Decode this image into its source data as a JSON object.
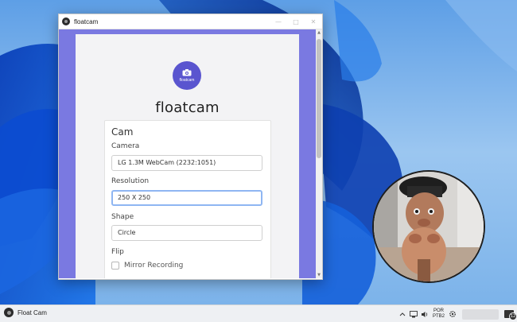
{
  "window": {
    "title": "floatcam"
  },
  "logo": {
    "caption": "floatcam"
  },
  "app_name": "floatcam",
  "cam_settings": {
    "section_title": "Cam",
    "camera": {
      "label": "Camera",
      "value": "LG 1.3M WebCam (2232:1051)"
    },
    "resolution": {
      "label": "Resolution",
      "value": "250 X 250"
    },
    "shape": {
      "label": "Shape",
      "value": "Circle"
    },
    "flip": {
      "label": "Flip",
      "mirror_label": "Mirror Recording",
      "mirror_checked": false
    }
  },
  "taskbar": {
    "app_label": "Float Cam",
    "language": {
      "line1": "POR",
      "line2": "PTB2"
    },
    "notification_count": "12"
  },
  "colors": {
    "content_background": "#7a79e1",
    "logo_background": "#5a55cf",
    "focus_ring": "#8fb6f2"
  }
}
